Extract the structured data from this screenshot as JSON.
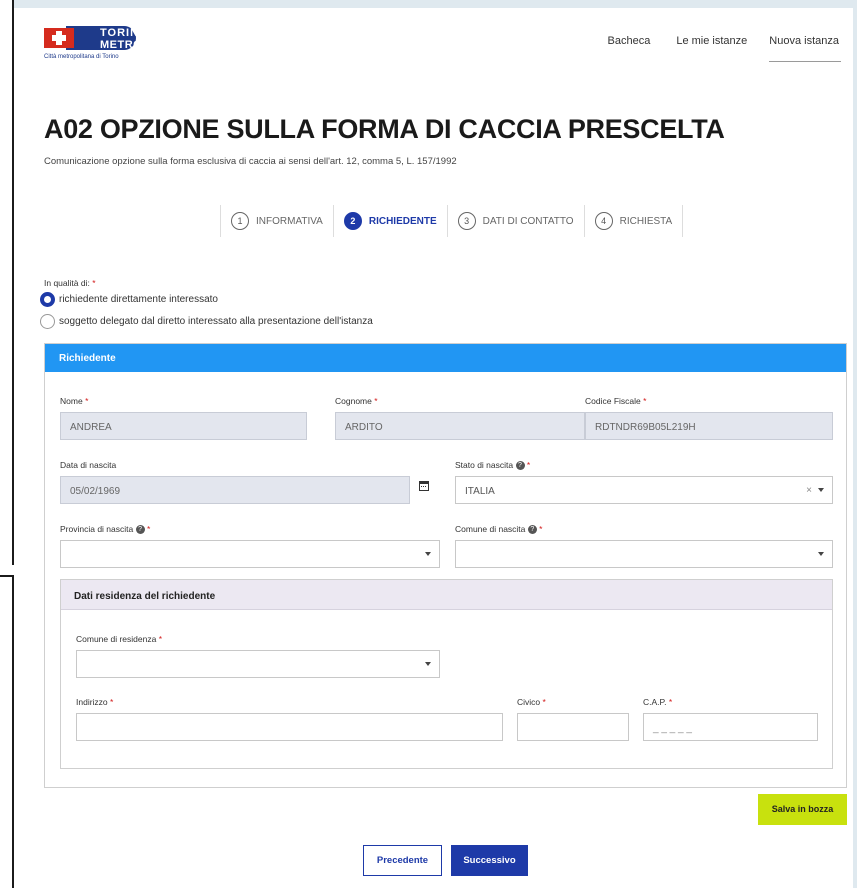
{
  "logo": {
    "line1": "TORINO",
    "line2": "METROPOLI",
    "subtitle": "Città metropolitana di Torino"
  },
  "nav": [
    "Bacheca",
    "Le mie istanze",
    "Nuova istanza"
  ],
  "page": {
    "title": "A02 OPZIONE SULLA FORMA DI CACCIA PRESCELTA",
    "subtitle": "Comunicazione opzione sulla forma esclusiva di caccia ai sensi dell'art. 12, comma 5, L. 157/1992"
  },
  "steps": [
    {
      "num": "1",
      "label": "INFORMATIVA"
    },
    {
      "num": "2",
      "label": "RICHIEDENTE"
    },
    {
      "num": "3",
      "label": "DATI DI CONTATTO"
    },
    {
      "num": "4",
      "label": "RICHIESTA"
    }
  ],
  "qualita": {
    "label": "In qualità di:",
    "option1": "richiedente direttamente interessato",
    "option2": "soggetto delegato dal diretto interessato alla presentazione dell'istanza"
  },
  "required_mark": "*",
  "help_glyph": "?",
  "richiedente": {
    "header": "Richiedente",
    "nome_label": "Nome",
    "nome_value": "ANDREA",
    "cognome_label": "Cognome",
    "cognome_value": "ARDITO",
    "cf_label": "Codice Fiscale",
    "cf_value": "RDTNDR69B05L219H",
    "data_label": "Data di nascita",
    "data_value": "05/02/1969",
    "stato_label": "Stato di nascita",
    "stato_value": "ITALIA",
    "provincia_label": "Provincia di nascita",
    "comune_label": "Comune di nascita"
  },
  "residenza": {
    "header": "Dati residenza del richiedente",
    "comune_label": "Comune di residenza",
    "indirizzo_label": "Indirizzo",
    "civico_label": "Civico",
    "cap_label": "C.A.P.",
    "cap_placeholder": "_ _ _ _ _"
  },
  "buttons": {
    "draft": "Salva in bozza",
    "prev": "Precedente",
    "next": "Successivo"
  },
  "colors": {
    "primary": "#1e3aa8",
    "panel_header": "#2196f3",
    "draft": "#c8e10e",
    "required": "#d21a1a"
  }
}
